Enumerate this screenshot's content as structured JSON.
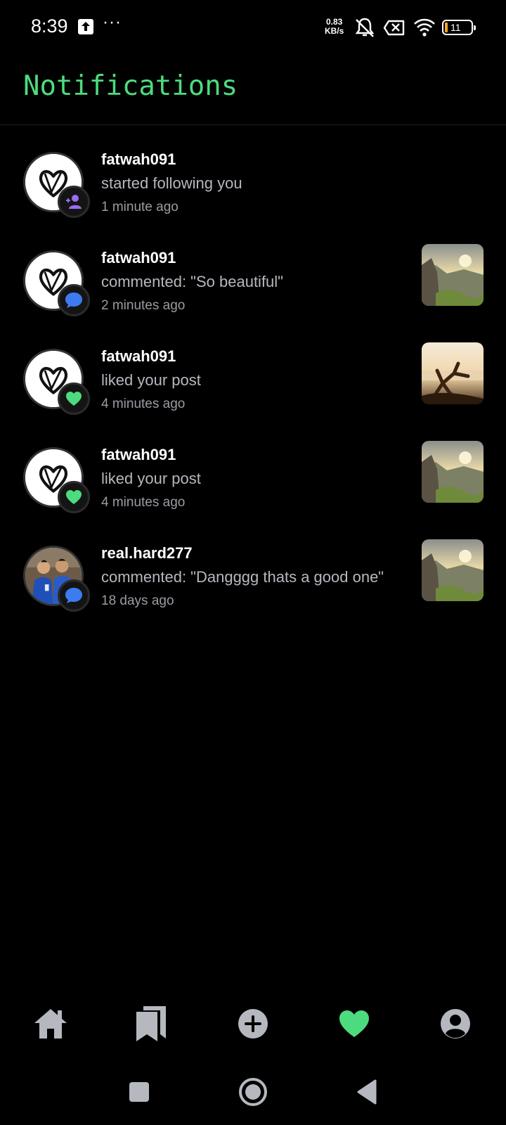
{
  "status_bar": {
    "time": "8:39",
    "ellipsis": "···",
    "net_speed_value": "0.83",
    "net_speed_unit": "KB/s",
    "battery_level": "11",
    "icons": [
      "upload-icon",
      "mute-icon",
      "no-sim-icon",
      "wifi-icon",
      "battery-icon"
    ]
  },
  "header": {
    "title": "Notifications"
  },
  "notifications": [
    {
      "username": "fatwah091",
      "action": "started following you",
      "time": "1 minute ago",
      "badge": "follow-icon",
      "has_thumbnail": false
    },
    {
      "username": "fatwah091",
      "action": "commented: \"So beautiful\"",
      "time": "2 minutes ago",
      "badge": "comment-icon",
      "has_thumbnail": true
    },
    {
      "username": "fatwah091",
      "action": "liked your post",
      "time": "4 minutes ago",
      "badge": "heart-icon",
      "has_thumbnail": true
    },
    {
      "username": "fatwah091",
      "action": "liked your post",
      "time": "4 minutes ago",
      "badge": "heart-icon",
      "has_thumbnail": true
    },
    {
      "username": "real.hard277",
      "action": "commented: \"Dangggg thats a good one\"",
      "time": "18 days ago",
      "badge": "comment-icon",
      "has_thumbnail": true
    }
  ],
  "bottom_nav": {
    "items": [
      "home-icon",
      "bookmarks-icon",
      "add-post-icon",
      "activity-heart-icon",
      "profile-icon"
    ],
    "active": "activity-heart-icon"
  },
  "colors": {
    "accent": "#4ddb7f",
    "follow_badge": "#9b6cf2",
    "comment_badge": "#3d7cf0",
    "like_badge": "#4ddb7f",
    "background": "#000000",
    "secondary_text": "#b6b8bf"
  }
}
